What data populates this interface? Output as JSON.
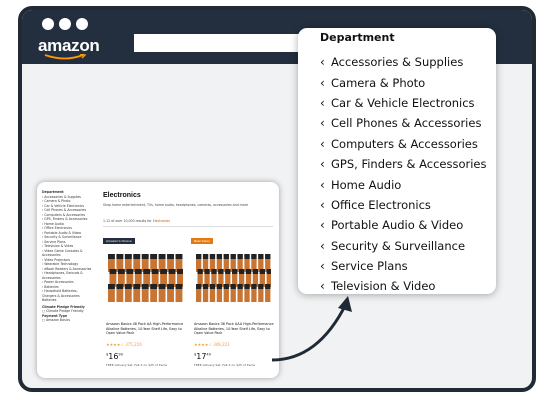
{
  "brand": {
    "logo_text": "amazon"
  },
  "colors": {
    "frame": "#232f3e",
    "badge_orange": "#c45500",
    "badge_dark": "#232f3e",
    "battery_copper": "#c87533"
  },
  "department_panel": {
    "title": "Department",
    "chevron_icon": "chevron-left-icon",
    "items": [
      "Accessories & Supplies",
      "Camera & Photo",
      "Car & Vehicle Electronics",
      "Cell Phones & Accessories",
      "Computers & Accessories",
      "GPS, Finders & Accessories",
      "Home Audio",
      "Office Electronics",
      "Portable Audio & Video",
      "Security & Surveillance",
      "Service Plans",
      "Television & Video"
    ]
  },
  "thumbnail": {
    "sidebar": {
      "heading": "Department",
      "items": [
        "‹ Accessories & Supplies",
        "‹ Camera & Photo",
        "‹ Car & Vehicle Electronics",
        "‹ Cell Phones & Accessories",
        "‹ Computers & Accessories",
        "‹ GPS, Finders & Accessories",
        "‹ Home Audio",
        "‹ Office Electronics",
        "‹ Portable Audio & Video",
        "‹ Security & Surveillance",
        "‹ Service Plans",
        "‹ Television & Video",
        "‹ Video Game Consoles &",
        "  Accessories",
        "‹ Video Projectors",
        "‹ Wearable Technology",
        "‹ eBook Readers & Accessories",
        "‹ Headphones, Earbuds &",
        "  Accessories",
        "‹ Power Accessories",
        "‹ Batteries",
        "‹ Household Batteries,",
        "  Chargers & Accessories",
        "  Batteries"
      ],
      "filter_heading": "Climate Pledge Friendly",
      "filter_option": "Climate Pledge Friendly",
      "filter2_heading": "Payment Type",
      "filter2_option": "Amazon Basics"
    },
    "title": "Electronics",
    "subtitle": "Shop home entertainment, TVs, home audio, headphones, cameras, accessories and more",
    "results_prefix": "1-12 of over 10,000 results for",
    "results_highlight": "Electronics",
    "cards": [
      {
        "badge": "Amazon's Choice",
        "description": "Amazon Basics 48 Pack AA High-Performance Alkaline Batteries, 10-Year Shelf Life, Easy to Open Value Pack",
        "count": "48 Count (Pack of 1)",
        "rating": "★★★★☆ 375,216",
        "price": "16",
        "price_cents": "99",
        "shipping": "FREE delivery Sat, Feb 4 on $25 of items"
      },
      {
        "badge": "Best Seller",
        "description": "Amazon Basics 36 Pack AAA High-Performance Alkaline Batteries, 10-Year Shelf Life, Easy to Open Value Pack",
        "count": "36 Count (Pack of 1)",
        "rating": "★★★★☆ 349,221",
        "price": "17",
        "price_cents": "49",
        "shipping": "FREE delivery Sat, Feb 4 on $25 of items"
      }
    ]
  }
}
